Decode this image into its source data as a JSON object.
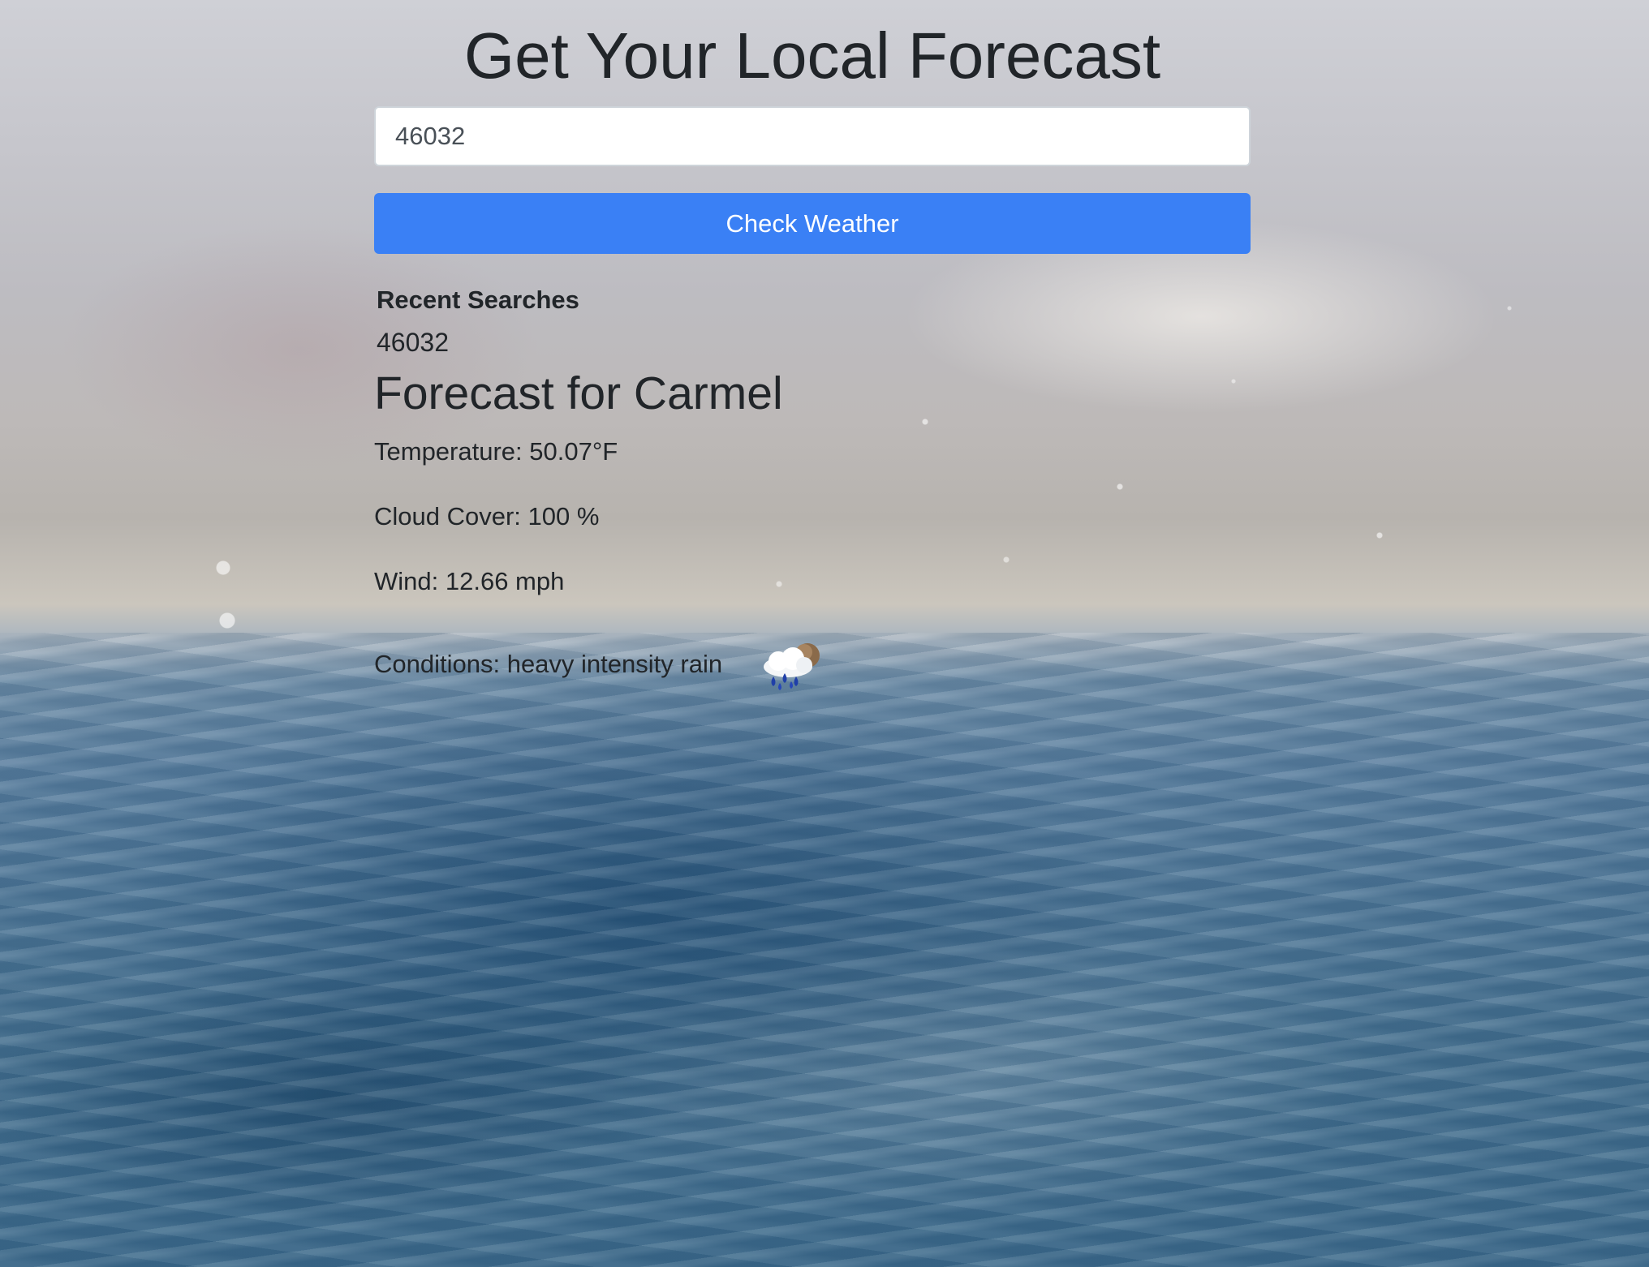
{
  "page": {
    "title": "Get Your Local Forecast"
  },
  "search": {
    "value": "46032",
    "button_label": "Check Weather"
  },
  "recent": {
    "heading": "Recent Searches",
    "items": [
      "46032"
    ]
  },
  "forecast": {
    "heading": "Forecast for Carmel",
    "temperature": "Temperature: 50.07°F",
    "cloud_cover": "Cloud Cover: 100 %",
    "wind": "Wind: 12.66 mph",
    "conditions": "Conditions: heavy intensity rain",
    "conditions_icon": "heavy-rain-cloud-icon"
  },
  "colors": {
    "button": "#3a80f5",
    "text": "#212529"
  }
}
